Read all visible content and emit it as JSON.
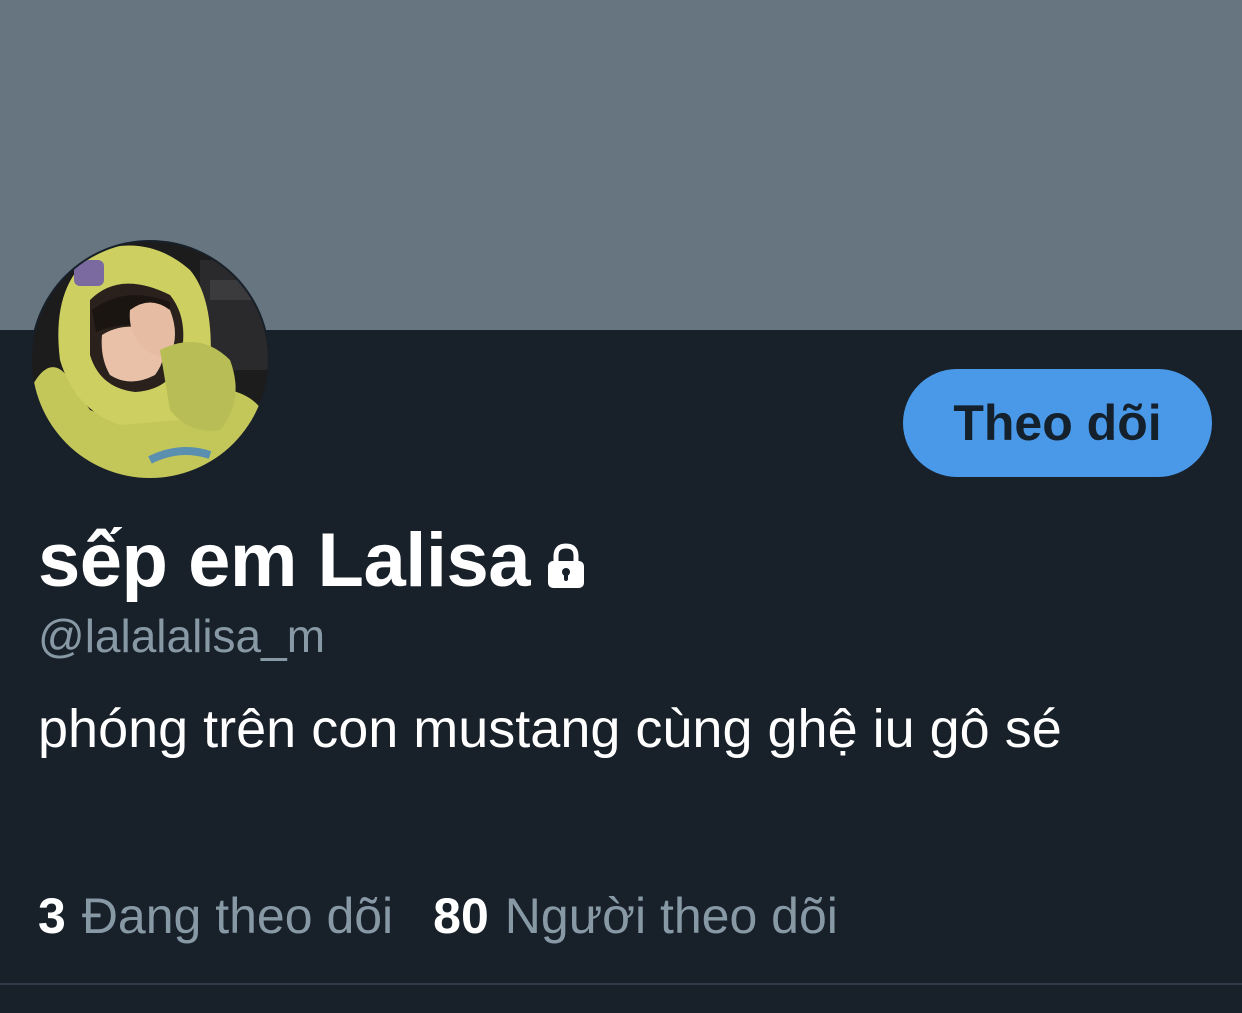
{
  "profile": {
    "display_name": "sếp em Lalisa",
    "handle": "@lalalalisa_m",
    "bio": "phóng trên con mustang cùng ghệ iu gô sé",
    "is_protected": true,
    "protected_icon": "lock-icon",
    "avatar_icon": "avatar"
  },
  "actions": {
    "follow_label": "Theo dõi"
  },
  "stats": {
    "following_count": "3",
    "following_label": "Đang theo dõi",
    "followers_count": "80",
    "followers_label": "Người theo dõi"
  },
  "colors": {
    "banner": "#66757f",
    "background": "#182029",
    "accent": "#4a99e9",
    "muted_text": "#8899a6",
    "text": "#ffffff"
  }
}
